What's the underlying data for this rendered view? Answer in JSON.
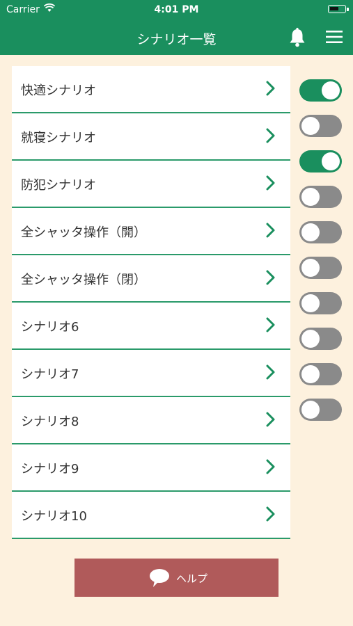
{
  "status": {
    "carrier": "Carrier",
    "time": "4:01 PM"
  },
  "nav": {
    "title": "シナリオ一覧",
    "bell_icon": "bell-icon",
    "menu_icon": "hamburger-menu-icon"
  },
  "scenarios": [
    {
      "label": "快適シナリオ",
      "enabled": true
    },
    {
      "label": "就寝シナリオ",
      "enabled": false
    },
    {
      "label": "防犯シナリオ",
      "enabled": true
    },
    {
      "label": "全シャッタ操作（開）",
      "enabled": false
    },
    {
      "label": "全シャッタ操作（閉）",
      "enabled": false
    },
    {
      "label": "シナリオ6",
      "enabled": false
    },
    {
      "label": "シナリオ7",
      "enabled": false
    },
    {
      "label": "シナリオ8",
      "enabled": false
    },
    {
      "label": "シナリオ9",
      "enabled": false
    },
    {
      "label": "シナリオ10",
      "enabled": false
    }
  ],
  "help": {
    "label": "ヘルプ",
    "icon": "speech-bubble-icon"
  },
  "colors": {
    "primary": "#1a8f5e",
    "background": "#fdf1de",
    "help_button": "#b05a5a",
    "toggle_off": "#8a8a8a"
  }
}
